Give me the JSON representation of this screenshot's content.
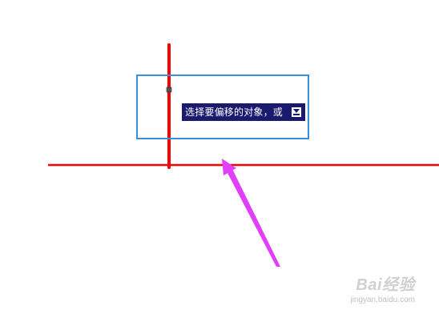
{
  "prompt": {
    "text": "选择要偏移的对象，或",
    "dropdown_icon": "dropdown-arrow-icon"
  },
  "watermark": {
    "logo_text": "Bai经验",
    "url": "jingyan.baidu.com"
  },
  "colors": {
    "line": "#ff0000",
    "selection_box": "#3b8fd9",
    "arrow": "#e040fb",
    "prompt_bg": "#1a1a6e",
    "grip": "#555555"
  }
}
